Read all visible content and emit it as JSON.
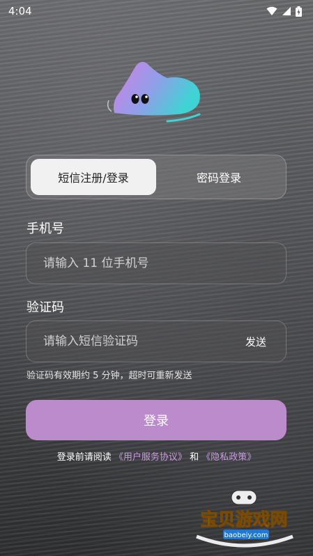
{
  "status_bar": {
    "time": "4:04"
  },
  "colors": {
    "accent": "#bb8bcb",
    "link": "#c89be0"
  },
  "tabs": [
    {
      "label": "短信注册/登录",
      "active": true
    },
    {
      "label": "密码登录",
      "active": false
    }
  ],
  "phone": {
    "label": "手机号",
    "placeholder": "请输入 11 位手机号",
    "value": ""
  },
  "code": {
    "label": "验证码",
    "placeholder": "请输入短信验证码",
    "value": "",
    "send_label": "发送"
  },
  "hint": "验证码有效期约 5 分钟，超时可重新发送",
  "login_button": "登录",
  "agreement": {
    "prefix": "登录前请阅读",
    "terms": "《用户服务协议》",
    "and": "和",
    "privacy": "《隐私政策》"
  },
  "watermark": {
    "title": "宝贝游戏网",
    "url": "baobeiy.com"
  },
  "icons": {
    "wifi": "wifi-icon",
    "signal": "signal-icon",
    "battery": "battery-icon",
    "logo": "mascot-logo-icon"
  }
}
